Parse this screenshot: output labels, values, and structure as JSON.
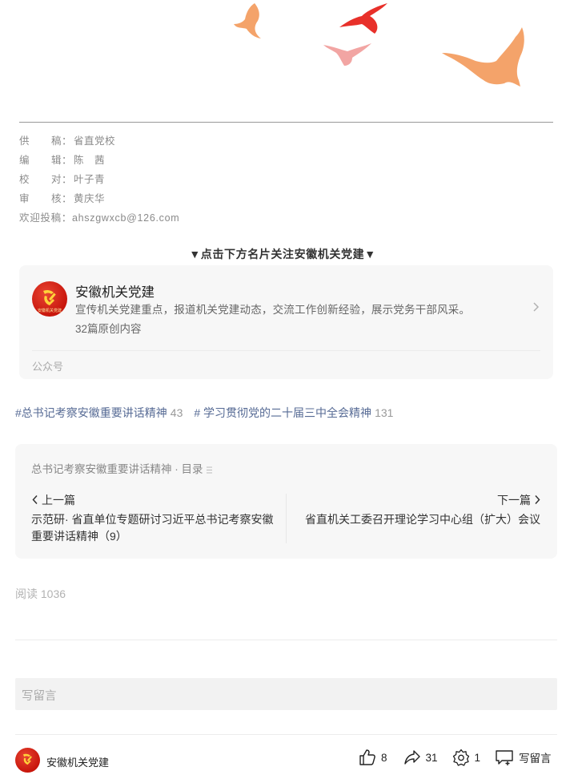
{
  "credits": [
    {
      "label": [
        "供",
        "稿"
      ],
      "value": "省直党校"
    },
    {
      "label": [
        "编",
        "辑"
      ],
      "value": "陈　茜"
    },
    {
      "label": [
        "校",
        "对"
      ],
      "value": "叶子青"
    },
    {
      "label": [
        "审",
        "核"
      ],
      "value": "黄庆华"
    }
  ],
  "submission": "欢迎投稿：ahszgwxcb@126.com",
  "follow_hint": "▼点击下方名片关注安徽机关党建▼",
  "profile": {
    "name": "安徽机关党建",
    "description": "宣传机关党建重点，报道机关党建动态，交流工作创新经验，展示党务干部风采。",
    "articles": "32篇原创内容",
    "type": "公众号",
    "avatar_text": "安徽机关党建"
  },
  "tags": [
    {
      "label": "#总书记考察安徽重要讲话精神",
      "count": "43"
    },
    {
      "label": "# 学习贯彻党的二十届三中全会精神",
      "count": "131"
    }
  ],
  "album": {
    "title": "总书记考察安徽重要讲话精神 · 目录",
    "prev_label": "上一篇",
    "next_label": "下一篇",
    "prev_title": "示范研· 省直单位专题研讨习近平总书记考察安徽重要讲话精神（9）",
    "next_title": "省直机关工委召开理论学习中心组（扩大）会议"
  },
  "read_count": "阅读 1036",
  "comment_placeholder": "写留言",
  "footer": {
    "name": "安徽机关党建",
    "likes": "8",
    "shares": "31",
    "wow": "1",
    "comment_label": "写留言"
  },
  "colors": {
    "link": "#576b95",
    "dove_orange": "#f4a36a",
    "dove_red": "#e8302a",
    "dove_pink": "#f2a5a3",
    "brand_red": "#c8160c"
  }
}
